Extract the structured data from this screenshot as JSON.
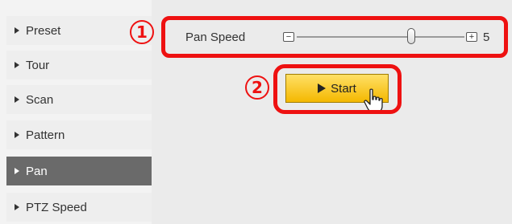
{
  "sidebar": {
    "items": [
      {
        "label": "Preset",
        "selected": false
      },
      {
        "label": "Tour",
        "selected": false
      },
      {
        "label": "Scan",
        "selected": false
      },
      {
        "label": "Pattern",
        "selected": false
      },
      {
        "label": "Pan",
        "selected": true
      },
      {
        "label": "PTZ Speed",
        "selected": false
      }
    ]
  },
  "pan_speed": {
    "label": "Pan Speed",
    "minus_label": "−",
    "plus_label": "+",
    "value": "5"
  },
  "start_button": {
    "label": "Start"
  },
  "annotations": {
    "marker_1": "①",
    "marker_2": "②",
    "highlight_color": "#ee1111"
  },
  "colors": {
    "selected_item_bg": "#6a6a6a",
    "start_button": "#f4b800"
  }
}
